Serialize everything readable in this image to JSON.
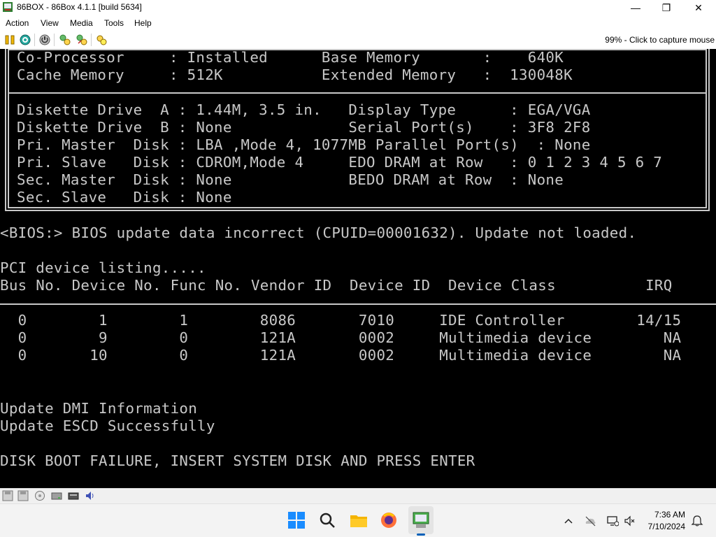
{
  "window": {
    "title": "86BOX - 86Box 4.1.1 [build 5634]",
    "minimize_glyph": "—",
    "restore_glyph": "❐",
    "close_glyph": "✕"
  },
  "menu": {
    "items": [
      "Action",
      "View",
      "Media",
      "Tools",
      "Help"
    ]
  },
  "toolbar": {
    "icons": [
      "pause-icon",
      "reset-icon",
      "power-icon",
      "settings-icon",
      "hard-reset-icon",
      "ctrl-alt-del-icon"
    ],
    "capture_text": "99% - Click to capture mouse"
  },
  "bios": {
    "summary_top": [
      "Co-Processor     : Installed      Base Memory       :    640K",
      "Cache Memory     : 512K           Extended Memory   :  130048K"
    ],
    "summary_drives": [
      "Diskette Drive  A : 1.44M, 3.5 in.   Display Type      : EGA/VGA",
      "Diskette Drive  B : None             Serial Port(s)    : 3F8 2F8",
      "Pri. Master  Disk : LBA ,Mode 4, 1077MB Parallel Port(s)  : None",
      "Pri. Slave   Disk : CDROM,Mode 4     EDO DRAM at Row   : 0 1 2 3 4 5 6 7",
      "Sec. Master  Disk : None             BEDO DRAM at Row  : None",
      "Sec. Slave   Disk : None"
    ],
    "cpuid_message": "<BIOS:> BIOS update data incorrect (CPUID=00001632). Update not loaded.",
    "pci_title": "PCI device listing.....",
    "pci_header": "Bus No. Device No. Func No. Vendor ID  Device ID  Device Class          IRQ",
    "pci_rows": [
      "  0        1        1        8086       7010     IDE Controller        14/15",
      "  0        9        0        121A       0002     Multimedia device        NA",
      "  0       10        0        121A       0002     Multimedia device        NA"
    ],
    "dmi_message": "Update DMI Information",
    "escd_message": "Update ESCD Successfully",
    "boot_failure": "DISK BOOT FAILURE, INSERT SYSTEM DISK AND PRESS ENTER"
  },
  "statusbar": {
    "icons": [
      "floppy-a-icon",
      "floppy-b-icon",
      "cdrom-icon",
      "hard-disk-icon",
      "keyboard-icon",
      "sound-icon"
    ]
  },
  "taskbar": {
    "apps": [
      "start-icon",
      "search-icon",
      "file-explorer-icon",
      "firefox-icon",
      "86box-icon"
    ],
    "tray": [
      "chevron-up-icon",
      "onedrive-icon",
      "network-icon",
      "volume-muted-icon",
      "notification-icon"
    ],
    "time": "7:36 AM",
    "date": "7/10/2024"
  },
  "colors": {
    "console_text": "#c8c8c8",
    "console_bg": "#000000",
    "taskbar_accent": "#005fb8"
  }
}
